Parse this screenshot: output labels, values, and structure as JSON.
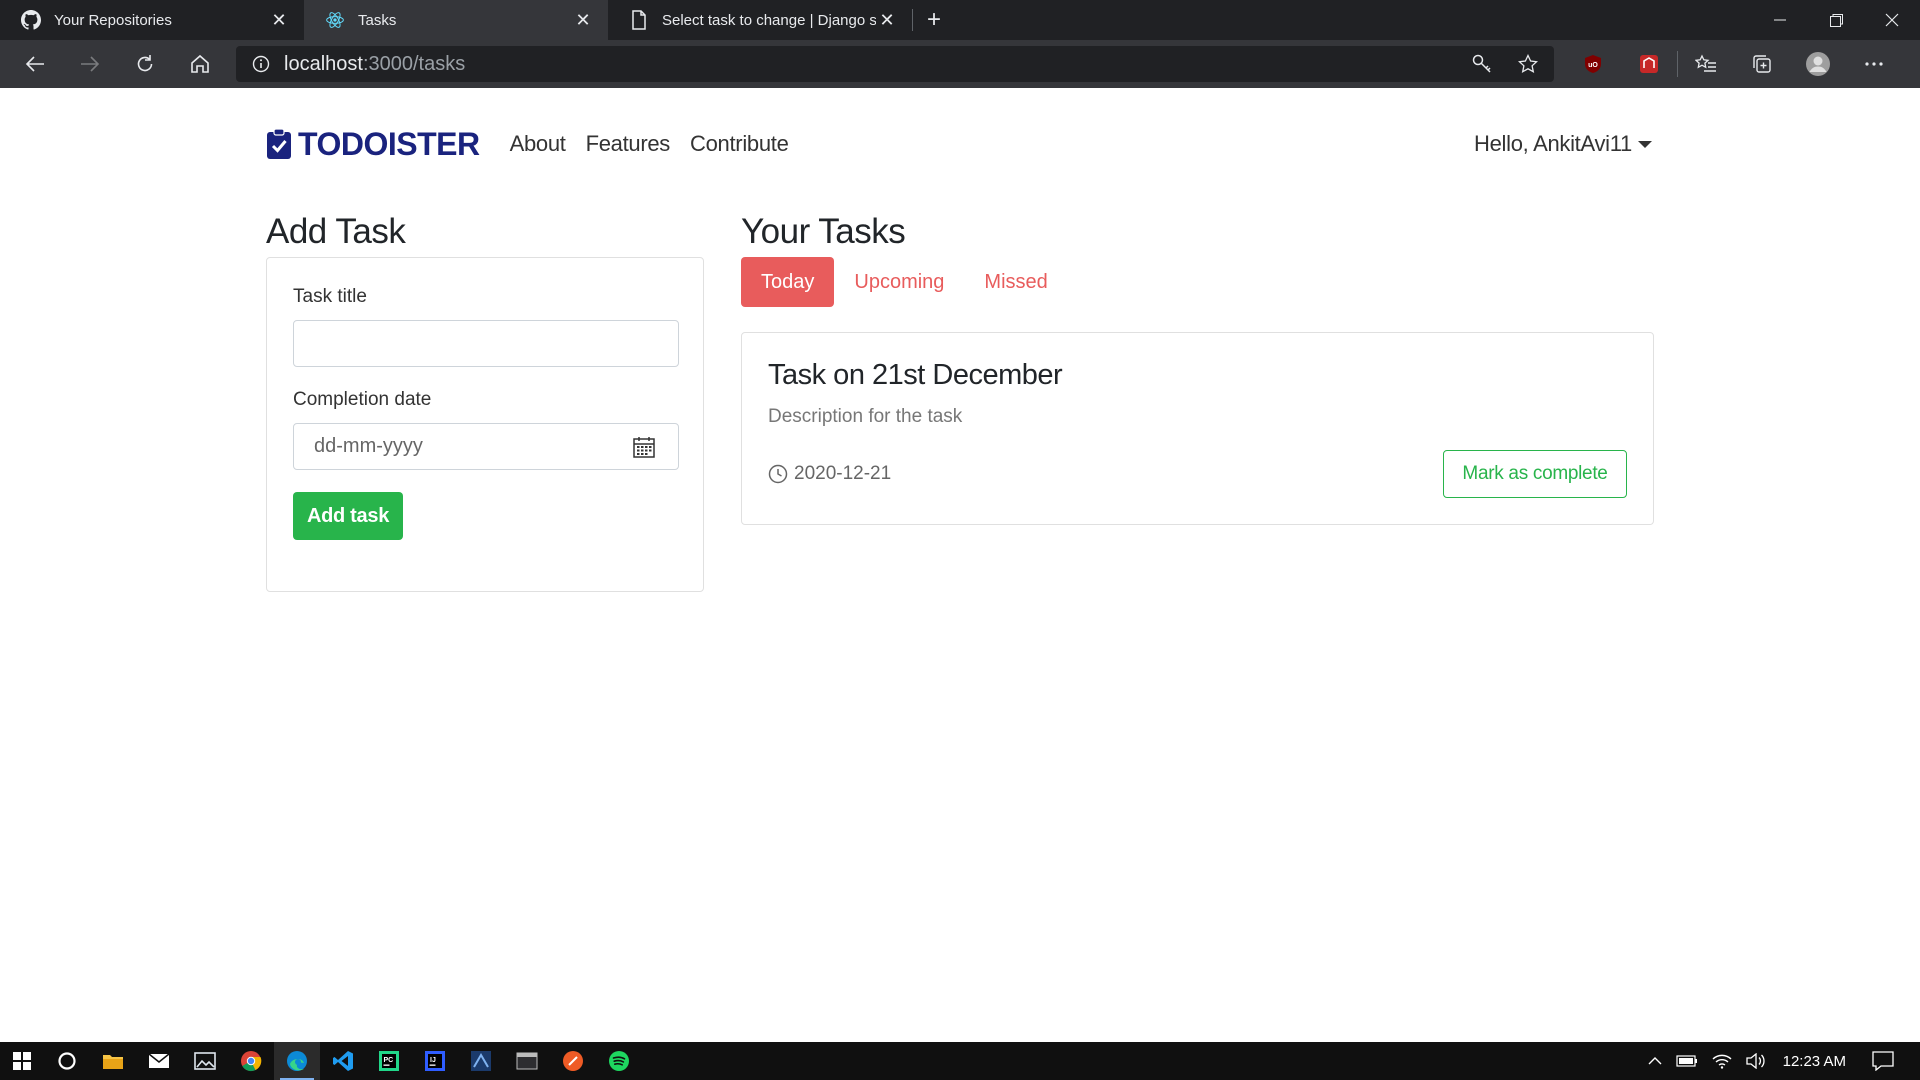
{
  "browser": {
    "tabs": [
      {
        "title": "Your Repositories",
        "icon": "github-icon",
        "active": false
      },
      {
        "title": "Tasks",
        "icon": "react-icon",
        "active": true
      },
      {
        "title": "Select task to change | Django si",
        "icon": "document-icon",
        "active": false
      }
    ],
    "url_host": "localhost",
    "url_path": ":3000/tasks"
  },
  "app": {
    "brand": "TODOISTER",
    "nav": [
      "About",
      "Features",
      "Contribute"
    ],
    "user_greeting": "Hello, AnkitAvi11"
  },
  "add_task": {
    "heading": "Add Task",
    "title_label": "Task title",
    "title_value": "",
    "date_label": "Completion date",
    "date_placeholder": "dd-mm-yyyy",
    "submit_label": "Add task"
  },
  "tasks": {
    "heading": "Your Tasks",
    "filters": [
      "Today",
      "Upcoming",
      "Missed"
    ],
    "active_filter": "Today",
    "items": [
      {
        "title": "Task on 21st December",
        "description": "Description for the task",
        "date": "2020-12-21",
        "action_label": "Mark as complete"
      }
    ]
  },
  "taskbar": {
    "time": "12:23 AM"
  },
  "colors": {
    "brand": "#1a237e",
    "accent_red": "#e85c5c",
    "success_green": "#28b44b"
  }
}
